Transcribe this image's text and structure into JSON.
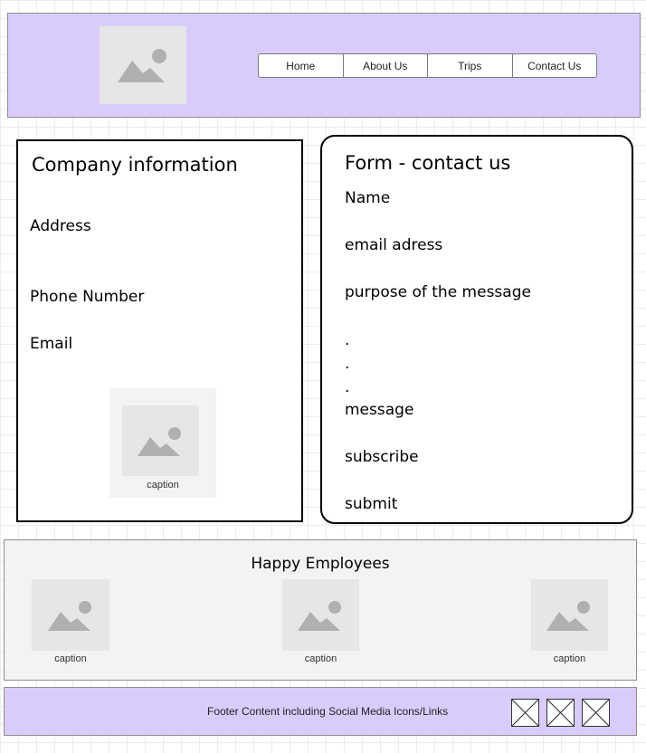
{
  "nav": {
    "items": [
      "Home",
      "About Us",
      "Trips",
      "Contact Us"
    ]
  },
  "company": {
    "title": "Company information",
    "address_label": "Address",
    "phone_label": "Phone Number",
    "email_label": "Email",
    "image_caption": "caption"
  },
  "form": {
    "title": "Form - contact us",
    "name_label": "Name",
    "email_label": "email adress",
    "purpose_label": "purpose of the message",
    "dots": [
      ".",
      ".",
      "."
    ],
    "message_label": "message",
    "subscribe_label": "subscribe",
    "submit_label": "submit"
  },
  "employees": {
    "title": "Happy Employees",
    "captions": [
      "caption",
      "caption",
      "caption"
    ]
  },
  "footer": {
    "text": "Footer Content including Social Media Icons/Links",
    "social_icons": [
      "placeholder-x-icon",
      "placeholder-x-icon",
      "placeholder-x-icon"
    ]
  },
  "colors": {
    "header_bg": "#d9ccfd",
    "footer_bg": "#d9ccfd",
    "panel_bg": "#f4f2f2",
    "placeholder_bg": "#e6e6e6",
    "placeholder_icon": "#b0b0b0"
  }
}
